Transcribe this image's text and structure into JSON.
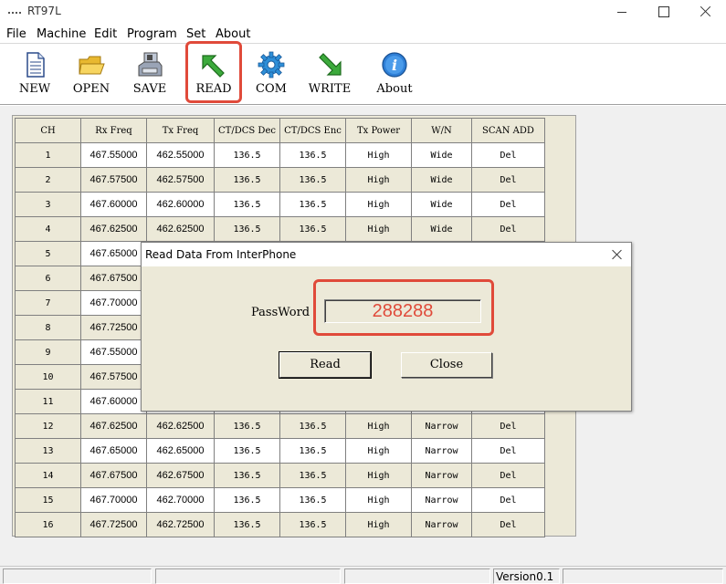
{
  "window": {
    "title": "RT97L"
  },
  "menu": {
    "items": [
      "File",
      "Machine",
      "Edit",
      "Program",
      "Set",
      "About"
    ]
  },
  "toolbar": {
    "buttons": [
      {
        "label": "NEW",
        "icon": "new-document-icon"
      },
      {
        "label": "OPEN",
        "icon": "open-folder-icon"
      },
      {
        "label": "SAVE",
        "icon": "save-disk-icon"
      },
      {
        "label": "READ",
        "icon": "read-arrow-icon"
      },
      {
        "label": "COM",
        "icon": "gear-icon"
      },
      {
        "label": "WRITE",
        "icon": "write-arrow-icon"
      },
      {
        "label": "About",
        "icon": "info-icon"
      }
    ],
    "highlighted": "READ",
    "highlight_color": "#e04a3a"
  },
  "grid": {
    "columns": [
      "CH",
      "Rx Freq",
      "Tx Freq",
      "CT/DCS Dec",
      "CT/DCS Enc",
      "Tx Power",
      "W/N",
      "SCAN ADD"
    ],
    "rows": [
      [
        "1",
        "467.55000",
        "462.55000",
        "136.5",
        "136.5",
        "High",
        "Wide",
        "Del"
      ],
      [
        "2",
        "467.57500",
        "462.57500",
        "136.5",
        "136.5",
        "High",
        "Wide",
        "Del"
      ],
      [
        "3",
        "467.60000",
        "462.60000",
        "136.5",
        "136.5",
        "High",
        "Wide",
        "Del"
      ],
      [
        "4",
        "467.62500",
        "462.62500",
        "136.5",
        "136.5",
        "High",
        "Wide",
        "Del"
      ],
      [
        "5",
        "467.65000",
        "",
        "",
        "",
        "",
        "",
        ""
      ],
      [
        "6",
        "467.67500",
        "",
        "",
        "",
        "",
        "",
        ""
      ],
      [
        "7",
        "467.70000",
        "",
        "",
        "",
        "",
        "",
        ""
      ],
      [
        "8",
        "467.72500",
        "",
        "",
        "",
        "",
        "",
        ""
      ],
      [
        "9",
        "467.55000",
        "",
        "",
        "",
        "",
        "",
        ""
      ],
      [
        "10",
        "467.57500",
        "",
        "",
        "",
        "",
        "",
        ""
      ],
      [
        "11",
        "467.60000",
        "",
        "",
        "",
        "",
        "",
        ""
      ],
      [
        "12",
        "467.62500",
        "462.62500",
        "136.5",
        "136.5",
        "High",
        "Narrow",
        "Del"
      ],
      [
        "13",
        "467.65000",
        "462.65000",
        "136.5",
        "136.5",
        "High",
        "Narrow",
        "Del"
      ],
      [
        "14",
        "467.67500",
        "462.67500",
        "136.5",
        "136.5",
        "High",
        "Narrow",
        "Del"
      ],
      [
        "15",
        "467.70000",
        "462.70000",
        "136.5",
        "136.5",
        "High",
        "Narrow",
        "Del"
      ],
      [
        "16",
        "467.72500",
        "462.72500",
        "136.5",
        "136.5",
        "High",
        "Narrow",
        "Del"
      ]
    ]
  },
  "dialog": {
    "title": "Read Data From InterPhone",
    "password_label": "PassWord",
    "password_value": "288288",
    "read_button": "Read",
    "close_button": "Close"
  },
  "statusbar": {
    "version": "Version0.1"
  }
}
